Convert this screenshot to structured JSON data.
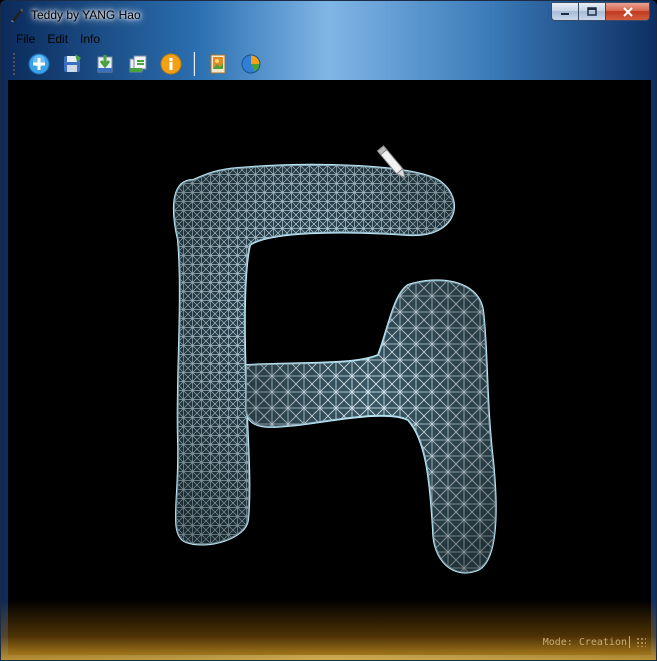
{
  "window": {
    "title": "Teddy by YANG Hao",
    "controls": {
      "minimize": "▭",
      "maximize": "☐",
      "close": "✕"
    }
  },
  "menu": {
    "items": [
      "File",
      "Edit",
      "Info"
    ]
  },
  "toolbar": {
    "buttons": [
      {
        "icon": "new-add-icon",
        "color": "#3aa0e8"
      },
      {
        "icon": "save-disk-icon",
        "color": "#3b6fbf"
      },
      {
        "icon": "import-arrow-icon",
        "color": "#4aa23c"
      },
      {
        "icon": "export-icon",
        "color": "#4aa23c"
      },
      {
        "icon": "info-icon",
        "color": "#f2a116"
      },
      {
        "icon": "texture-picture-icon",
        "color": "#e08a2a"
      },
      {
        "icon": "pie-chart-icon",
        "color": "#2f7fd8"
      }
    ]
  },
  "viewport": {
    "background": "#000000",
    "mesh_color": "#cfeefb",
    "shading_color": "#3a5a66"
  },
  "status": {
    "mode_text": "Mode: Creation"
  }
}
